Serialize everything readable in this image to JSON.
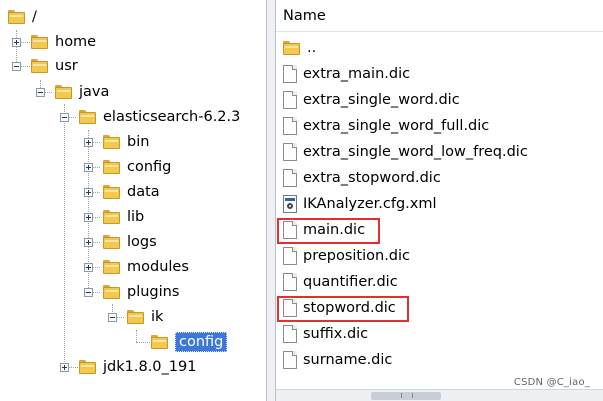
{
  "tree": {
    "root": "/",
    "home": "home",
    "usr": "usr",
    "java": "java",
    "elasticsearch": "elasticsearch-6.2.3",
    "bin": "bin",
    "config": "config",
    "data": "data",
    "lib": "lib",
    "logs": "logs",
    "modules": "modules",
    "plugins": "plugins",
    "ik": "ik",
    "ik_config": "config",
    "jdk": "jdk1.8.0_191"
  },
  "list": {
    "header": "Name",
    "items": [
      "..",
      "extra_main.dic",
      "extra_single_word.dic",
      "extra_single_word_full.dic",
      "extra_single_word_low_freq.dic",
      "extra_stopword.dic",
      "IKAnalyzer.cfg.xml",
      "main.dic",
      "preposition.dic",
      "quantifier.dic",
      "stopword.dic",
      "suffix.dic",
      "surname.dic"
    ],
    "highlighted": [
      "main.dic",
      "stopword.dic"
    ]
  },
  "watermark": "CSDN @C_iao_",
  "colors": {
    "highlight": "#e03030",
    "selection": "#3b78d8",
    "folder": "#f2c94c"
  }
}
